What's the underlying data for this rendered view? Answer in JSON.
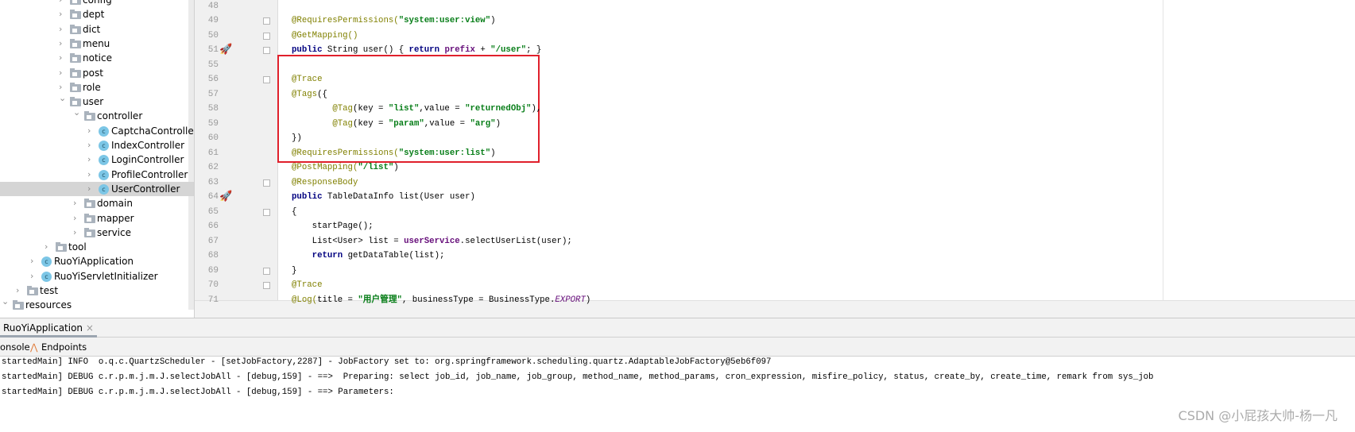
{
  "project_tree": [
    {
      "label": "config",
      "type": "folder",
      "level": 3,
      "expanded": false
    },
    {
      "label": "dept",
      "type": "folder",
      "level": 3,
      "expanded": false
    },
    {
      "label": "dict",
      "type": "folder",
      "level": 3,
      "expanded": false
    },
    {
      "label": "menu",
      "type": "folder",
      "level": 3,
      "expanded": false
    },
    {
      "label": "notice",
      "type": "folder",
      "level": 3,
      "expanded": false
    },
    {
      "label": "post",
      "type": "folder",
      "level": 3,
      "expanded": false
    },
    {
      "label": "role",
      "type": "folder",
      "level": 3,
      "expanded": false
    },
    {
      "label": "user",
      "type": "folder",
      "level": 3,
      "expanded": true
    },
    {
      "label": "controller",
      "type": "folder",
      "level": 4,
      "expanded": true
    },
    {
      "label": "CaptchaController",
      "type": "class",
      "level": 5,
      "expanded": false
    },
    {
      "label": "IndexController",
      "type": "class",
      "level": 5,
      "expanded": false
    },
    {
      "label": "LoginController",
      "type": "class",
      "level": 5,
      "expanded": false
    },
    {
      "label": "ProfileController",
      "type": "class",
      "level": 5,
      "expanded": false
    },
    {
      "label": "UserController",
      "type": "class",
      "level": 5,
      "expanded": false,
      "selected": true
    },
    {
      "label": "domain",
      "type": "folder",
      "level": 4,
      "expanded": false
    },
    {
      "label": "mapper",
      "type": "folder",
      "level": 4,
      "expanded": false
    },
    {
      "label": "service",
      "type": "folder",
      "level": 4,
      "expanded": false
    },
    {
      "label": "tool",
      "type": "folder",
      "level": 2,
      "expanded": false
    },
    {
      "label": "RuoYiApplication",
      "type": "class",
      "level": 1,
      "expanded": false
    },
    {
      "label": "RuoYiServletInitializer",
      "type": "class",
      "level": 1,
      "expanded": false
    },
    {
      "label": "test",
      "type": "folder",
      "level": 0,
      "expanded": false
    },
    {
      "label": "resources",
      "type": "folder",
      "level": -1,
      "expanded": true
    }
  ],
  "editor": {
    "lines": [
      {
        "n": "48",
        "tokens": []
      },
      {
        "n": "49",
        "fold": true,
        "tokens": [
          [
            "@RequiresPermissions(",
            "ann"
          ],
          [
            "\"system:user:view\"",
            "str"
          ],
          [
            ")",
            ""
          ]
        ]
      },
      {
        "n": "50",
        "fold": true,
        "tokens": [
          [
            "@GetMapping()",
            "ann"
          ]
        ]
      },
      {
        "n": "51",
        "rocket": true,
        "fold": true,
        "tokens": [
          [
            "public ",
            "kw"
          ],
          [
            "String user() { ",
            ""
          ],
          [
            "return ",
            "kw"
          ],
          [
            "prefix",
            "fld"
          ],
          [
            " + ",
            ""
          ],
          [
            "\"/user\"",
            "str"
          ],
          [
            "; }",
            ""
          ]
        ]
      },
      {
        "n": "55",
        "tokens": []
      },
      {
        "n": "56",
        "fold": true,
        "tokens": [
          [
            "@Trace",
            "ann"
          ]
        ]
      },
      {
        "n": "57",
        "tokens": [
          [
            "@Tags",
            "ann"
          ],
          [
            "({",
            ""
          ]
        ]
      },
      {
        "n": "58",
        "tokens": [
          [
            "        ",
            ""
          ],
          [
            "@Tag",
            "ann"
          ],
          [
            "(key = ",
            ""
          ],
          [
            "\"list\"",
            "str"
          ],
          [
            ",value = ",
            ""
          ],
          [
            "\"returnedObj\"",
            "str"
          ],
          [
            "),",
            ""
          ]
        ]
      },
      {
        "n": "59",
        "tokens": [
          [
            "        ",
            ""
          ],
          [
            "@Tag",
            "ann"
          ],
          [
            "(key = ",
            ""
          ],
          [
            "\"param\"",
            "str"
          ],
          [
            ",value = ",
            ""
          ],
          [
            "\"arg\"",
            "str"
          ],
          [
            ")",
            ""
          ]
        ]
      },
      {
        "n": "60",
        "tokens": [
          [
            "})",
            ""
          ]
        ]
      },
      {
        "n": "61",
        "tokens": [
          [
            "@RequiresPermissions(",
            "ann"
          ],
          [
            "\"system:user:list\"",
            "str"
          ],
          [
            ")",
            ""
          ]
        ]
      },
      {
        "n": "62",
        "tokens": [
          [
            "@PostMapping(",
            "ann"
          ],
          [
            "\"/list\"",
            "str"
          ],
          [
            ")",
            ""
          ]
        ]
      },
      {
        "n": "63",
        "fold": true,
        "tokens": [
          [
            "@ResponseBody",
            "ann"
          ]
        ]
      },
      {
        "n": "64",
        "rocket": true,
        "tokens": [
          [
            "public ",
            "kw"
          ],
          [
            "TableDataInfo list(User user)",
            ""
          ]
        ]
      },
      {
        "n": "65",
        "fold": true,
        "tokens": [
          [
            "{",
            ""
          ]
        ]
      },
      {
        "n": "66",
        "tokens": [
          [
            "    startPage();",
            ""
          ]
        ]
      },
      {
        "n": "67",
        "tokens": [
          [
            "    List<User> list = ",
            ""
          ],
          [
            "userService",
            "fld"
          ],
          [
            ".selectUserList(user);",
            ""
          ]
        ]
      },
      {
        "n": "68",
        "tokens": [
          [
            "    ",
            ""
          ],
          [
            "return ",
            "kw"
          ],
          [
            "getDataTable(list);",
            ""
          ]
        ]
      },
      {
        "n": "69",
        "fold": true,
        "tokens": [
          [
            "}",
            ""
          ]
        ]
      },
      {
        "n": "70",
        "fold": true,
        "tokens": [
          [
            "@Trace",
            "ann"
          ]
        ]
      },
      {
        "n": "71",
        "tokens": [
          [
            "@Log(",
            "ann"
          ],
          [
            "title = ",
            ""
          ],
          [
            "\"用户管理\"",
            "str"
          ],
          [
            ", businessType = BusinessType.",
            ""
          ],
          [
            "EXPORT",
            "ital"
          ],
          [
            ")",
            ""
          ]
        ]
      }
    ]
  },
  "run_panel": {
    "tab_label": "RuoYiApplication",
    "close_glyph": "×",
    "console_tab": "onsole",
    "endpoints_tab": "Endpoints",
    "lines": [
      "startedMain] INFO  o.q.c.QuartzScheduler - [setJobFactory,2287] - JobFactory set to: org.springframework.scheduling.quartz.AdaptableJobFactory@5eb6f097",
      "startedMain] DEBUG c.r.p.m.j.m.J.selectJobAll - [debug,159] - ==>  Preparing: select job_id, job_name, job_group, method_name, method_params, cron_expression, misfire_policy, status, create_by, create_time, remark from sys_job",
      "startedMain] DEBUG c.r.p.m.j.m.J.selectJobAll - [debug,159] - ==> Parameters:"
    ]
  },
  "watermark": "CSDN @小屁孩大帅-杨一凡",
  "colors": {
    "highlight_box": "#e0202c",
    "annotation": "#808000",
    "string": "#067d17",
    "keyword": "#000080",
    "field": "#660e7a"
  }
}
